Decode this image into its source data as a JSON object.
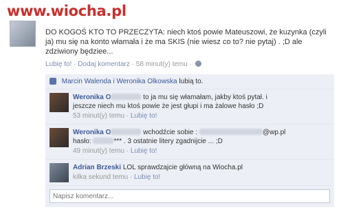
{
  "watermark": {
    "text": "www.wiocha.pl"
  },
  "post": {
    "text": "DO KOGOŚ KTO TO PRZECZYTA: niech ktoś powie Mateuszowi, że kuzynka (czyli ja) mu się na konto włamała i że ma SKIS (nie wiesz co to? nie pytaj) . ;D ale zdziwiony będziee...",
    "like_label": "Lubię to!",
    "comment_label": "Dodaj komentarz",
    "time": "58 minut(y) temu",
    "separator": "·"
  },
  "likes": {
    "names": "Marcin Walenda i Weronika Olkowska",
    "suffix": "lubią to."
  },
  "comments": [
    {
      "name": "Weronika O",
      "text1": "to ja mu się włamałam, jakby ktoś pytał. i",
      "text2": "jeszcze niech mu ktoś powie że jest głupi i ma żalowe hasło ;D",
      "time": "53 minut(y) temu",
      "like_label": "Lubię to!"
    },
    {
      "name": "Weronika O",
      "text1a": "wchodźcie sobie :",
      "text1b": "@wp.pl",
      "text2a": "hasło:",
      "text2b": "*** . 3 ostatnie litery zgadnijcie ... ;D",
      "time": "49 minut(y) temu",
      "like_label": "Lubię to!"
    },
    {
      "name": "Adrian Brzeski",
      "text": "LOL sprawdzajcie główną na Wiocha.pl",
      "time": "kilka sekund temu",
      "like_label": "Lubię to!"
    }
  ],
  "write_comment": {
    "placeholder": "Napisz komentarz..."
  }
}
